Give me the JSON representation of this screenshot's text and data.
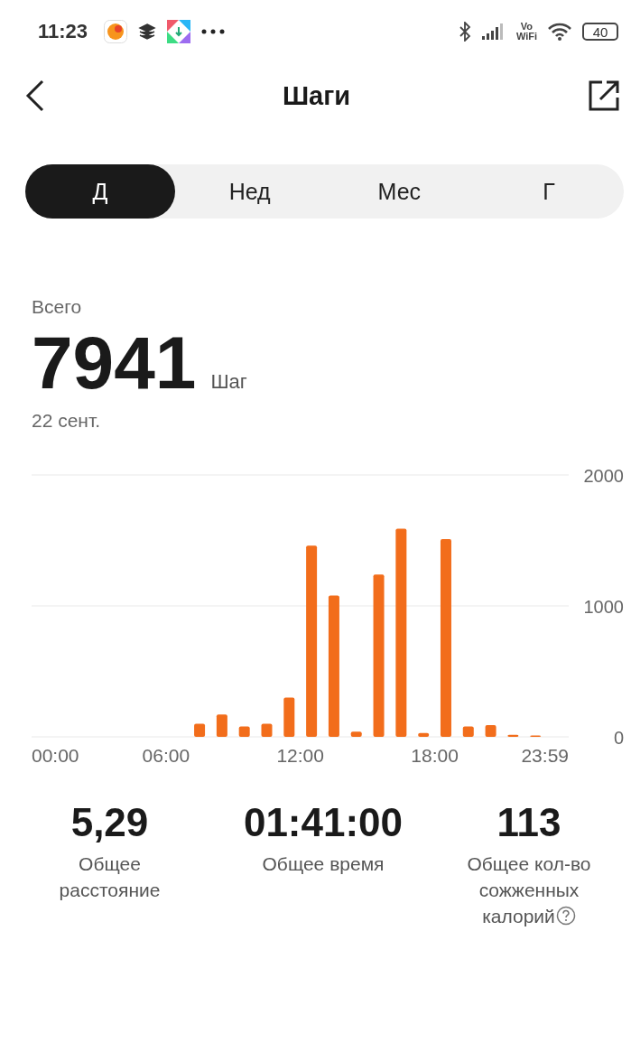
{
  "status_bar": {
    "time": "11:23",
    "vowifi_top": "Vo",
    "vowifi_bottom": "WiFi",
    "battery": "40"
  },
  "header": {
    "title": "Шаги"
  },
  "tabs": [
    {
      "label": "Д",
      "selected": true
    },
    {
      "label": "Нед",
      "selected": false
    },
    {
      "label": "Мес",
      "selected": false
    },
    {
      "label": "Г",
      "selected": false
    }
  ],
  "summary": {
    "caption": "Всего",
    "total": "7941",
    "unit": "Шаг",
    "date": "22 сент."
  },
  "chart": {
    "chart_data": {
      "type": "bar",
      "x": [
        7.5,
        8.5,
        9.5,
        10.5,
        11.5,
        12.5,
        13.5,
        14.5,
        15.5,
        16.5,
        17.5,
        18.5,
        19.5,
        20.5,
        21.5,
        22.5
      ],
      "values": [
        100,
        170,
        80,
        100,
        300,
        1460,
        1080,
        40,
        1240,
        1590,
        30,
        1510,
        80,
        90,
        15,
        10
      ],
      "color": "#f26d1b",
      "xlim": [
        0,
        23.983
      ],
      "ylim": [
        0,
        2000
      ],
      "yticks": [
        0,
        1000,
        2000
      ],
      "xticks": [
        {
          "value": 0,
          "label": "00:00"
        },
        {
          "value": 6,
          "label": "06:00"
        },
        {
          "value": 12,
          "label": "12:00"
        },
        {
          "value": 18,
          "label": "18:00"
        },
        {
          "value": 23.983,
          "label": "23:59"
        }
      ]
    }
  },
  "stats": [
    {
      "value": "5,29",
      "label": "Общее расстояние",
      "info": false
    },
    {
      "value": "01:41:00",
      "label": "Общее время",
      "info": false
    },
    {
      "value": "113",
      "label": "Общее кол-во сожженных калорий",
      "info": true
    }
  ]
}
